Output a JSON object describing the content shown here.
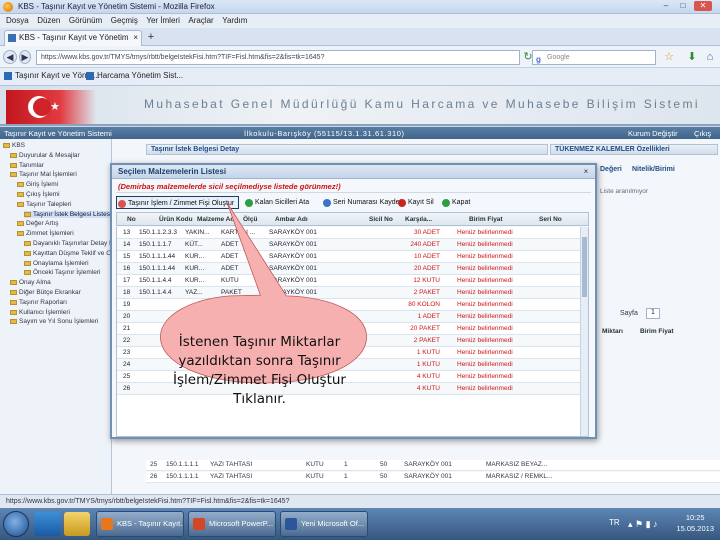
{
  "browser": {
    "window_title": "KBS - Taşınır Kayıt ve Yönetim Sistemi - Mozilla Firefox",
    "menu": [
      "Dosya",
      "Düzen",
      "Görünüm",
      "Geçmiş",
      "Yer İmleri",
      "Araçlar",
      "Yardım"
    ],
    "tab_label": "KBS - Taşınır Kayıt ve Yönetim Sistemi",
    "tab_close": "×",
    "new_tab": "+",
    "url": "https://www.kbs.gov.tr/TMYS/tmys/rbtt/belgeIstekFisi.htm?TIF=Fisl.htm&fis=2&fis=tk=1645?",
    "search_placeholder": "Google",
    "bookmarks": [
      "Taşınır Kayıt ve Yönet...",
      "Harcama Yönetim Sist..."
    ]
  },
  "app": {
    "banner_title": "Muhasebat Genel Müdürlüğü Kamu Harcama ve Muhasebe Bilişim Sistemi",
    "module": "Taşınır Kayıt ve Yönetim Sistemi",
    "unit": "İlkokulu-Barışköy (55115/13.1.31.61.310)",
    "change_role": "Kurum Değiştir",
    "logout": "Çıkış"
  },
  "tree": [
    {
      "label": "KBS",
      "depth": 0,
      "selected": false
    },
    {
      "label": "Duyurular & Mesajlar",
      "depth": 1,
      "selected": false
    },
    {
      "label": "Tanımlar",
      "depth": 1,
      "selected": false
    },
    {
      "label": "Taşınır Mal İşlemleri",
      "depth": 1,
      "selected": false
    },
    {
      "label": "Giriş İşlemi",
      "depth": 2,
      "selected": false
    },
    {
      "label": "Çıkış İşlemi",
      "depth": 2,
      "selected": false
    },
    {
      "label": "Taşınır Talepleri",
      "depth": 2,
      "selected": false
    },
    {
      "label": "Taşınır İstek Belgesi Listesi",
      "depth": 3,
      "selected": true
    },
    {
      "label": "Değer Artış",
      "depth": 2,
      "selected": false
    },
    {
      "label": "Zimmet İşlemleri",
      "depth": 2,
      "selected": false
    },
    {
      "label": "Dayanıklı Taşınırlar Detay Bilgileri",
      "depth": 3,
      "selected": false
    },
    {
      "label": "Kayıttan Düşme Teklif ve Onay",
      "depth": 3,
      "selected": false
    },
    {
      "label": "Onaylama İşlemleri",
      "depth": 3,
      "selected": false
    },
    {
      "label": "Önceki Taşınır İşlemleri",
      "depth": 3,
      "selected": false
    },
    {
      "label": "Onay Alma",
      "depth": 1,
      "selected": false
    },
    {
      "label": "Diğer Bütçe Ekrankar",
      "depth": 1,
      "selected": false
    },
    {
      "label": "Taşınır Raporları",
      "depth": 1,
      "selected": false
    },
    {
      "label": "Kullanıcı İşlemleri",
      "depth": 1,
      "selected": false
    },
    {
      "label": "Sayım ve Yıl Sonu İşlemleri",
      "depth": 1,
      "selected": false
    }
  ],
  "background": {
    "main_header": "Taşınır İstek Belgesi Detay",
    "right_header": "TÜKENMEZ KALEMLER Özellikleri",
    "right_tabs": [
      "Değeri",
      "Nitelik/Birimi"
    ],
    "right_hint": "Liste aranılmıyor",
    "pager_label": "Sayfa",
    "pager_value": "1",
    "cols": [
      "Miktarı",
      "Birim Fiyat"
    ],
    "rows": [
      {
        "no": "25",
        "code": "150.1.1.1.1",
        "name": "YAZI TAHTASI",
        "unit": "KUTU",
        "qty": "1",
        "amount": "50",
        "store": "SARAYKÖY 001",
        "place": "MARKASIZ BEYAZ..."
      },
      {
        "no": "26",
        "code": "150.1.1.1.1",
        "name": "YAZI TAHTASI",
        "unit": "KUTU",
        "qty": "1",
        "amount": "50",
        "store": "SARAYKÖY 001",
        "place": "MARKASIZ / REMKL..."
      }
    ]
  },
  "dialog": {
    "title": "Seçilen Malzemelerin Listesi",
    "close": "×",
    "warning": "(Demirbaş malzemelerde sicil seçilmediyse listede görünmez!)",
    "toolbar": [
      {
        "label": "Taşınır İşlem / Zimmet Fişi Oluştur",
        "color": "#d9534f"
      },
      {
        "label": "Kalan Sicilleri Ata",
        "color": "#2e9e45"
      },
      {
        "label": "Seri Numarası Kaydet",
        "color": "#3a75c4"
      },
      {
        "label": "Kayıt Sil",
        "color": "#cc2222"
      },
      {
        "label": "Kapat",
        "color": "#2e9e45"
      }
    ],
    "columns": [
      "No",
      "Ürün Kodu",
      "Malzeme Adı",
      "Ölçü",
      "Ambar Adı",
      "Sicil No",
      "Karşıla...",
      "Birim Fiyat",
      "Seri No"
    ],
    "rows": [
      {
        "no": "13",
        "code": "150.1.1.2.3.3",
        "name": "YAKIN...",
        "unit": "KARTON ...",
        "store": "SARAYKÖY 001",
        "qty": "30 ADET",
        "note": "Henüz belirlenmedi"
      },
      {
        "no": "14",
        "code": "150.1.1.1.7",
        "name": "KÜT...",
        "unit": "ADET",
        "store": "SARAYKÖY 001",
        "qty": "240 ADET",
        "note": "Henüz belirlenmedi"
      },
      {
        "no": "15",
        "code": "150.1.1.1.44",
        "name": "KUR...",
        "unit": "ADET",
        "store": "SARAYKÖY 001",
        "qty": "10 ADET",
        "note": "Henüz belirlenmedi"
      },
      {
        "no": "16",
        "code": "150.1.1.1.44",
        "name": "KUR...",
        "unit": "ADET",
        "store": "SARAYKÖY 001",
        "qty": "20 ADET",
        "note": "Henüz belirlenmedi"
      },
      {
        "no": "17",
        "code": "150.1.1.4.4",
        "name": "KUR...",
        "unit": "KUTU",
        "store": "SARAYKÖY 001",
        "qty": "12 KUTU",
        "note": "Henüz belirlenmedi"
      },
      {
        "no": "18",
        "code": "150.1.1.4.4",
        "name": "YAZ...",
        "unit": "PAKET",
        "store": "SARAYKÖY 001",
        "qty": "2 PAKET",
        "note": "Henüz belirlenmedi"
      },
      {
        "no": "19",
        "code": "",
        "name": "",
        "unit": "",
        "store": "",
        "qty": "80 KOLON",
        "note": "Henüz belirlenmedi"
      },
      {
        "no": "20",
        "code": "",
        "name": "",
        "unit": "",
        "store": "",
        "qty": "1 ADET",
        "note": "Henüz belirlenmedi"
      },
      {
        "no": "21",
        "code": "",
        "name": "",
        "unit": "",
        "store": "",
        "qty": "20 PAKET",
        "note": "Henüz belirlenmedi"
      },
      {
        "no": "22",
        "code": "",
        "name": "",
        "unit": "",
        "store": "",
        "qty": "2 PAKET",
        "note": "Henüz belirlenmedi"
      },
      {
        "no": "23",
        "code": "",
        "name": "",
        "unit": "",
        "store": "",
        "qty": "1 KUTU",
        "note": "Henüz belirlenmedi"
      },
      {
        "no": "24",
        "code": "",
        "name": "",
        "unit": "",
        "store": "",
        "qty": "1 KUTU",
        "note": "Henüz belirlenmedi"
      },
      {
        "no": "25",
        "code": "",
        "name": "",
        "unit": "",
        "store": "",
        "qty": "4 KUTU",
        "note": "Henüz belirlenmedi"
      },
      {
        "no": "26",
        "code": "",
        "name": "",
        "unit": "",
        "store": "",
        "qty": "4 KUTU",
        "note": "Henüz belirlenmedi"
      }
    ]
  },
  "callout": {
    "lines": [
      "İstenen Taşınır Miktarlar",
      "yazıldıktan sonra Taşınır",
      "İşlem/Zimmet Fişi Oluştur",
      "Tıklanır."
    ],
    "fill": "#f7b0b0",
    "stroke": "#c05a5a"
  },
  "statusbar": {
    "text": "https://www.kbs.gov.tr/TMYS/tmys/rbtt/belgeIstekFisi.htm?TIF=Fisl.htm&fis=2&fis=tk=1645?"
  },
  "taskbar": {
    "tasks": [
      {
        "label": "KBS - Taşınır Kayıt...",
        "color": "#e8761e"
      },
      {
        "label": "Microsoft PowerP...",
        "color": "#d24726"
      },
      {
        "label": "Yeni Microsoft Of...",
        "color": "#2b579a"
      }
    ],
    "lang": "TR",
    "time": "10:25",
    "date": "15.05.2013"
  }
}
